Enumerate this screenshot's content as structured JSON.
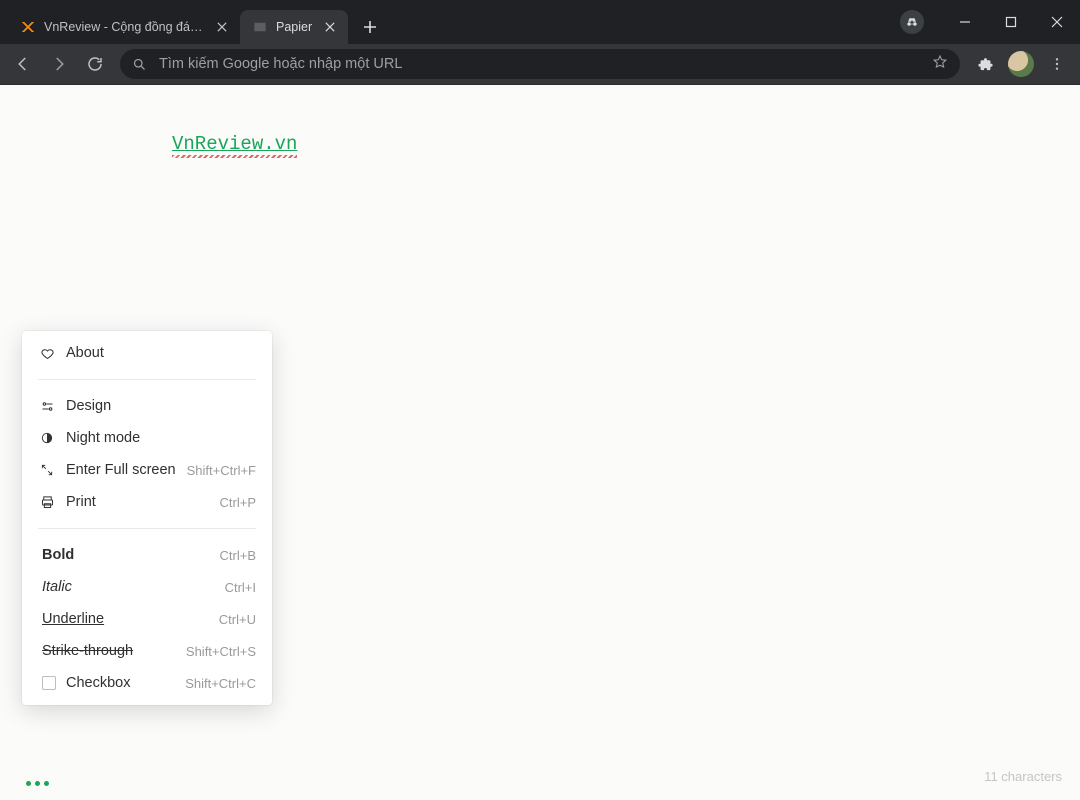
{
  "browser": {
    "tabs": [
      {
        "title": "VnReview - Cộng đồng đánh giá…"
      },
      {
        "title": "Papier"
      }
    ],
    "omnibox_placeholder": "Tìm kiếm Google hoặc nhập một URL"
  },
  "editor": {
    "text": "VnReview.vn"
  },
  "menu": {
    "about": "About",
    "design": "Design",
    "night_mode": "Night mode",
    "full_screen": {
      "label": "Enter Full screen",
      "shortcut": "Shift+Ctrl+F"
    },
    "print": {
      "label": "Print",
      "shortcut": "Ctrl+P"
    },
    "bold": {
      "label": "Bold",
      "shortcut": "Ctrl+B"
    },
    "italic": {
      "label": "Italic",
      "shortcut": "Ctrl+I"
    },
    "underline": {
      "label": "Underline",
      "shortcut": "Ctrl+U"
    },
    "strike": {
      "label": "Strike-through",
      "shortcut": "Shift+Ctrl+S"
    },
    "checkbox": {
      "label": "Checkbox",
      "shortcut": "Shift+Ctrl+C"
    }
  },
  "footer": {
    "char_count": "11 characters"
  }
}
